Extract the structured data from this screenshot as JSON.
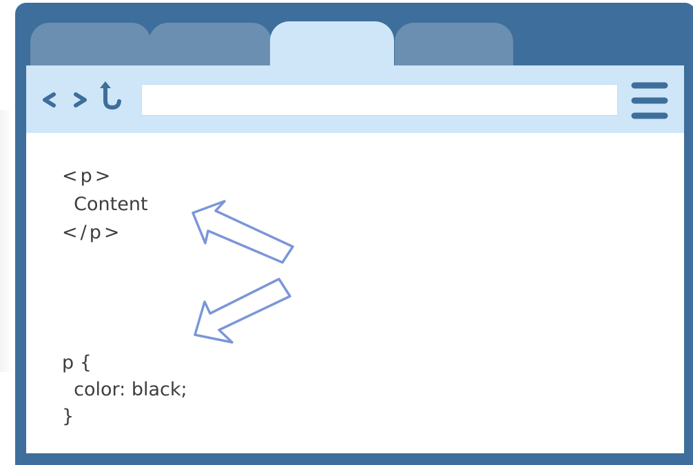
{
  "browser": {
    "tabs": [
      {
        "name": "tab-1",
        "active": false
      },
      {
        "name": "tab-2",
        "active": false
      },
      {
        "name": "tab-3",
        "active": true
      },
      {
        "name": "tab-4",
        "active": false
      }
    ],
    "toolbar": {
      "icons": [
        "back-icon",
        "forward-icon",
        "reload-icon",
        "menu-icon"
      ],
      "address_value": ""
    },
    "colors": {
      "frame": "#3e6e9b",
      "toolbar": "#cfe6f9",
      "inactive_tab": "#6a8fb1",
      "arrow_stroke": "#7b96d8"
    }
  },
  "html_snippet": {
    "open_tag": "<p>",
    "content": "  Content",
    "close_tag": "</p>"
  },
  "css_snippet": {
    "selector_line": "p {",
    "declaration": "  color: black;",
    "close_brace": "}"
  }
}
